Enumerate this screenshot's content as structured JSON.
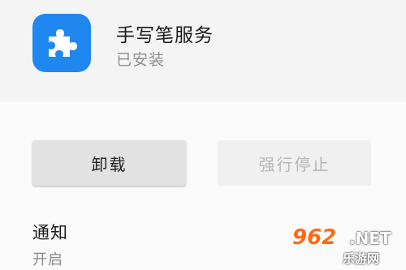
{
  "app": {
    "name": "手写笔服务",
    "status": "已安装",
    "icon": "puzzle-icon",
    "icon_color": "#1e88f0"
  },
  "buttons": {
    "uninstall": "卸载",
    "force_stop": "强行停止"
  },
  "notification": {
    "title": "通知",
    "value": "开启"
  },
  "watermark": {
    "digits": "962",
    "suffix": ".NET",
    "sub": "乐游网"
  }
}
